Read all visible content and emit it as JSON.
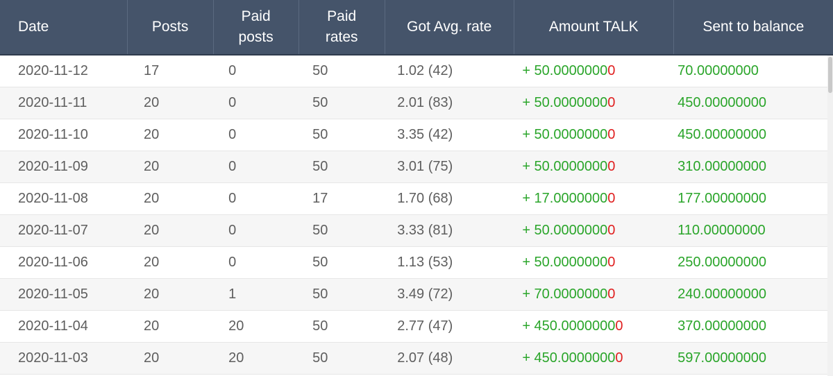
{
  "table": {
    "headers": {
      "date": "Date",
      "posts": "Posts",
      "paid_posts_line1": "Paid",
      "paid_posts_line2": "posts",
      "paid_rates_line1": "Paid",
      "paid_rates_line2": "rates",
      "avg_rate": "Got Avg. rate",
      "amount": "Amount TALK",
      "sent": "Sent to balance"
    },
    "rows": [
      {
        "date": "2020-11-12",
        "posts": "17",
        "paid_posts": "0",
        "paid_rates": "50",
        "avg_rate": "1.02 (42)",
        "amount_main": "+ 50.0000000",
        "amount_tail": "0",
        "sent": "70.00000000"
      },
      {
        "date": "2020-11-11",
        "posts": "20",
        "paid_posts": "0",
        "paid_rates": "50",
        "avg_rate": "2.01 (83)",
        "amount_main": "+ 50.0000000",
        "amount_tail": "0",
        "sent": "450.00000000"
      },
      {
        "date": "2020-11-10",
        "posts": "20",
        "paid_posts": "0",
        "paid_rates": "50",
        "avg_rate": "3.35 (42)",
        "amount_main": "+ 50.0000000",
        "amount_tail": "0",
        "sent": "450.00000000"
      },
      {
        "date": "2020-11-09",
        "posts": "20",
        "paid_posts": "0",
        "paid_rates": "50",
        "avg_rate": "3.01 (75)",
        "amount_main": "+ 50.0000000",
        "amount_tail": "0",
        "sent": "310.00000000"
      },
      {
        "date": "2020-11-08",
        "posts": "20",
        "paid_posts": "0",
        "paid_rates": "17",
        "avg_rate": "1.70 (68)",
        "amount_main": "+ 17.0000000",
        "amount_tail": "0",
        "sent": "177.00000000"
      },
      {
        "date": "2020-11-07",
        "posts": "20",
        "paid_posts": "0",
        "paid_rates": "50",
        "avg_rate": "3.33 (81)",
        "amount_main": "+ 50.0000000",
        "amount_tail": "0",
        "sent": "110.00000000"
      },
      {
        "date": "2020-11-06",
        "posts": "20",
        "paid_posts": "0",
        "paid_rates": "50",
        "avg_rate": "1.13 (53)",
        "amount_main": "+ 50.0000000",
        "amount_tail": "0",
        "sent": "250.00000000"
      },
      {
        "date": "2020-11-05",
        "posts": "20",
        "paid_posts": "1",
        "paid_rates": "50",
        "avg_rate": "3.49 (72)",
        "amount_main": "+ 70.0000000",
        "amount_tail": "0",
        "sent": "240.00000000"
      },
      {
        "date": "2020-11-04",
        "posts": "20",
        "paid_posts": "20",
        "paid_rates": "50",
        "avg_rate": "2.77 (47)",
        "amount_main": "+ 450.0000000",
        "amount_tail": "0",
        "sent": "370.00000000"
      },
      {
        "date": "2020-11-03",
        "posts": "20",
        "paid_posts": "20",
        "paid_rates": "50",
        "avg_rate": "2.07 (48)",
        "amount_main": "+ 450.0000000",
        "amount_tail": "0",
        "sent": "597.00000000"
      }
    ]
  },
  "colors": {
    "header_bg": "#45546a",
    "positive": "#2aa52a",
    "trailing_digit": "#e02020"
  }
}
